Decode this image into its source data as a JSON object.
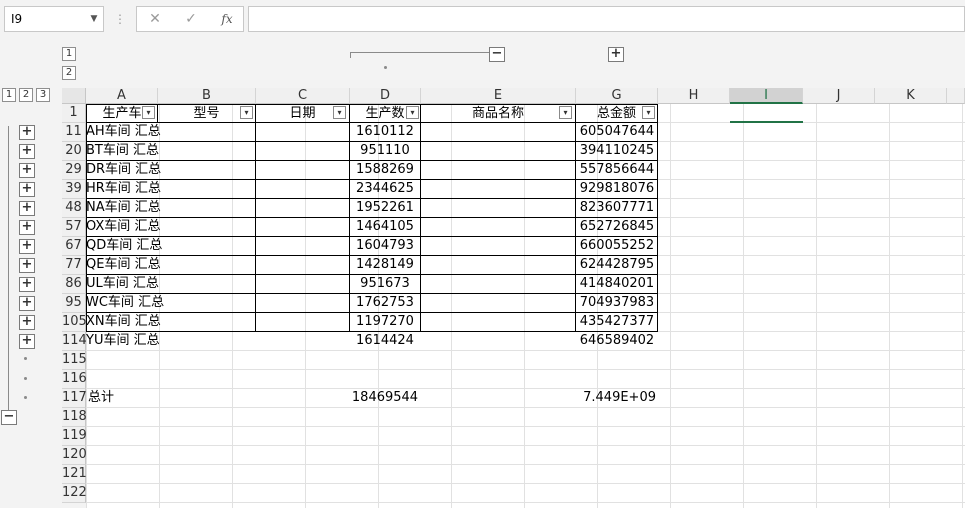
{
  "name_box": "I9",
  "formula_bar": {
    "cancel_icon": "✕",
    "enter_icon": "✓",
    "fx_label": "fx",
    "value": ""
  },
  "outline": {
    "levels": [
      "1",
      "2",
      "3"
    ],
    "col_levels": [
      "1",
      "2"
    ],
    "expand_symbol": "+",
    "collapse_symbol": "−"
  },
  "columns": [
    "A",
    "B",
    "C",
    "D",
    "E",
    "F",
    "G",
    "H",
    "I",
    "J",
    "K"
  ],
  "selected_column": "I",
  "header_row": {
    "row": "1",
    "a": "生产车",
    "b": "型号",
    "c": "日期",
    "d": "生产数",
    "e": "商品名称",
    "g": "总金额"
  },
  "rows": [
    {
      "row": "11",
      "a": "AH车间 汇总",
      "d": "1610112",
      "g": "605047644"
    },
    {
      "row": "20",
      "a": "BT车间 汇总",
      "d": "951110",
      "g": "394110245"
    },
    {
      "row": "29",
      "a": "DR车间 汇总",
      "d": "1588269",
      "g": "557856644"
    },
    {
      "row": "39",
      "a": "HR车间 汇总",
      "d": "2344625",
      "g": "929818076"
    },
    {
      "row": "48",
      "a": "NA车间 汇总",
      "d": "1952261",
      "g": "823607771"
    },
    {
      "row": "57",
      "a": "OX车间 汇总",
      "d": "1464105",
      "g": "652726845"
    },
    {
      "row": "67",
      "a": "QD车间 汇总",
      "d": "1604793",
      "g": "660055252"
    },
    {
      "row": "77",
      "a": "QE车间 汇总",
      "d": "1428149",
      "g": "624428795"
    },
    {
      "row": "86",
      "a": "UL车间 汇总",
      "d": "951673",
      "g": "414840201"
    },
    {
      "row": "95",
      "a": "WC车间 汇总",
      "d": "1762753",
      "g": "704937983"
    },
    {
      "row": "105",
      "a": "XN车间 汇总",
      "d": "1197270",
      "g": "435427377"
    },
    {
      "row": "114",
      "a": "YU车间 汇总",
      "d": "1614424",
      "g": "646589402"
    }
  ],
  "empty_rows_a": [
    "115",
    "116"
  ],
  "total_row": {
    "row": "117",
    "a": "总计",
    "d": "18469544",
    "g": "7.449E+09"
  },
  "empty_rows_b": [
    "118",
    "119",
    "120",
    "121",
    "122"
  ]
}
